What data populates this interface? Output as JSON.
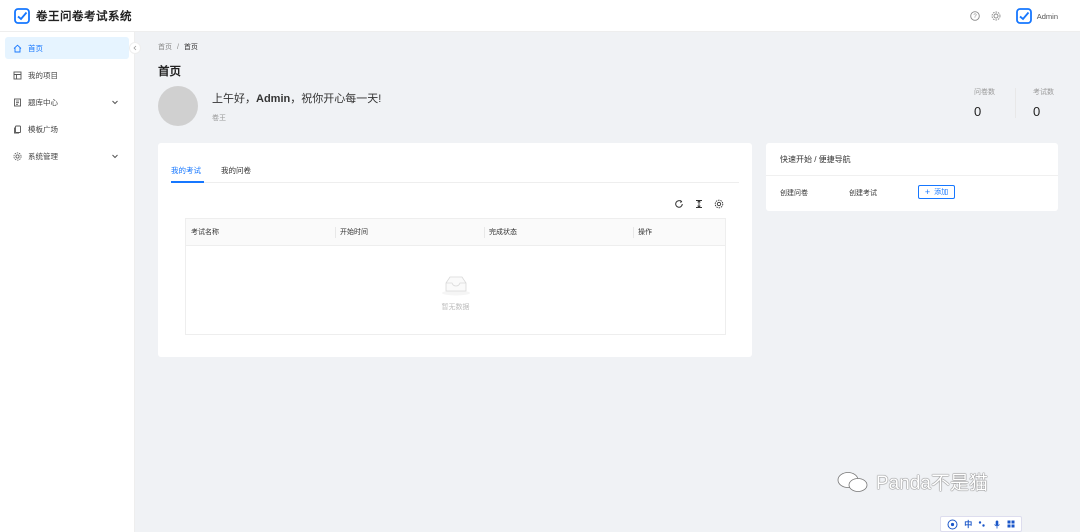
{
  "app": {
    "title": "卷王问卷考试系统",
    "username": "Admin"
  },
  "sidebar": {
    "items": [
      {
        "label": "首页",
        "icon": "home-icon",
        "active": true
      },
      {
        "label": "我的项目",
        "icon": "project-icon"
      },
      {
        "label": "题库中心",
        "icon": "question-bank-icon",
        "expandable": true
      },
      {
        "label": "模板广场",
        "icon": "template-icon"
      },
      {
        "label": "系统管理",
        "icon": "settings-icon",
        "expandable": true
      }
    ]
  },
  "breadcrumb": {
    "root": "首页",
    "separator": "/",
    "current": "首页"
  },
  "page": {
    "title": "首页"
  },
  "welcome": {
    "greeting_prefix": "上午好，",
    "greeting_name": "Admin",
    "greeting_suffix": "，祝你开心每一天!",
    "subtitle": "卷王"
  },
  "stats": [
    {
      "label": "问卷数",
      "value": "0"
    },
    {
      "label": "考试数",
      "value": "0"
    }
  ],
  "tabs": [
    {
      "label": "我的考试",
      "active": true
    },
    {
      "label": "我的问卷"
    }
  ],
  "table": {
    "columns": [
      "考试名称",
      "开始时间",
      "完成状态",
      "操作"
    ],
    "empty_text": "暂无数据"
  },
  "quick_start": {
    "title": "快速开始 / 便捷导航",
    "links": [
      "创建问卷",
      "创建考试"
    ],
    "add_label": "添加"
  },
  "watermark": {
    "text": "Panda不是猫"
  },
  "ime": {
    "mode": "中"
  },
  "colors": {
    "primary": "#1677ff",
    "background": "#f0f2f5"
  }
}
